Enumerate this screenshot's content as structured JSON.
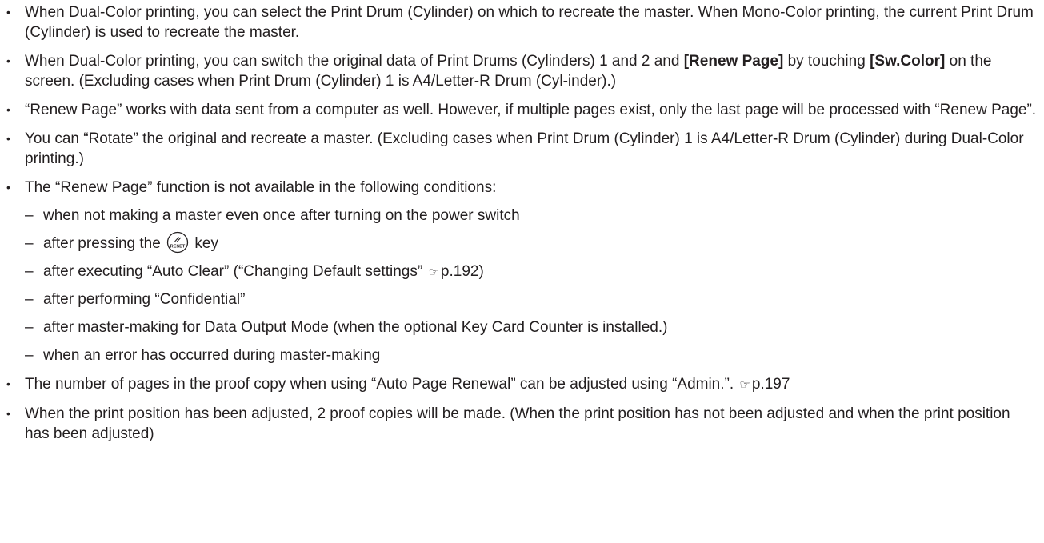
{
  "bullet_symbol": "•",
  "dash_symbol": "–",
  "pointer_icon_glyph": "☞",
  "reset_icon": {
    "name": "reset-key-icon",
    "label": "RESET"
  },
  "items": [
    {
      "text": "When Dual-Color printing, you can select the Print Drum (Cylinder) on which to recreate the master. When Mono-Color printing, the current Print Drum (Cylinder) is used to recreate the master."
    },
    {
      "part1": "When Dual-Color printing, you can switch the original data of Print Drums (Cylinders) 1 and 2 and ",
      "bold1": "[Renew Page]",
      "part2": " by touching ",
      "bold2": "[Sw.Color]",
      "part3": " on the screen. (Excluding cases when Print Drum (Cylinder) 1 is A4/Letter-R Drum (Cyl-inder).)"
    },
    {
      "text": "“Renew Page” works with data sent from a computer as well. However, if multiple pages exist, only the last page will be processed with “Renew Page”."
    },
    {
      "text": "You can “Rotate” the original and recreate a master. (Excluding cases when Print Drum (Cylinder) 1 is A4/Letter-R Drum (Cylinder) during Dual-Color printing.)"
    },
    {
      "text": "The “Renew Page” function is not available in the following conditions:",
      "sub_items": [
        {
          "text": "when not making a master even once after turning on the power switch"
        },
        {
          "before": "after pressing the ",
          "after": " key"
        },
        {
          "before": "after executing “Auto Clear” (“Changing Default settings” ",
          "ref": "p.192",
          "after": ")"
        },
        {
          "text": "after performing “Confidential”"
        },
        {
          "text": "after master-making for Data Output Mode (when the optional Key Card Counter is installed.)"
        },
        {
          "text": "when an error has occurred during master-making"
        }
      ]
    },
    {
      "text": "The number of pages in the proof copy when using “Auto Page Renewal” can be adjusted using “Admin.”. ",
      "ref": "p.197"
    },
    {
      "text": "When the print position has been adjusted, 2 proof copies will be made. (When the print position has not been adjusted and when the print position has been adjusted)"
    }
  ]
}
